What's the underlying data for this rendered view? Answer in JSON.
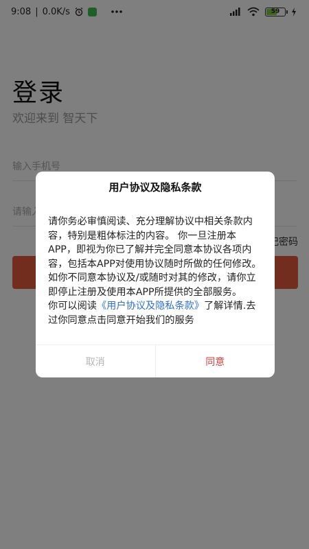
{
  "status_bar": {
    "time": "9:08",
    "network_speed": "0.0K/s",
    "battery_level": "59",
    "icons": [
      "alarm-icon",
      "app-badge-icon",
      "more-dots-icon",
      "hd-signal-icon",
      "wifi-icon",
      "battery-icon",
      "charging-icon"
    ]
  },
  "login": {
    "title": "登录",
    "subtitle": "欢迎来到 智天下",
    "phone_placeholder": "输入手机号",
    "password_placeholder": "请输入密码",
    "forgot_password": "忘记密码",
    "button_color": "#e55a3c"
  },
  "dialog": {
    "title": "用户协议及隐私条款",
    "body_paragraph": "请你务必审慎阅读、充分理解协议中相关条款内容，特别是粗体标注的内容。 你一旦注册本APP，即视为你已了解并完全同意本协议各项内容，包括本APP对使用协议随时所做的任何修改。 如你不同意本协议及/或随时对其的修改，请你立即停止注册及使用本APP所提供的全部服务。",
    "read_prefix": "你可以阅读",
    "policy_link": "《用户协议及隐私条款》",
    "read_suffix": "了解详情.去过你同意点击同意开始我们的服务",
    "cancel_label": "取消",
    "agree_label": "同意",
    "link_color": "#2f6fd6",
    "agree_color": "#e0413a"
  }
}
